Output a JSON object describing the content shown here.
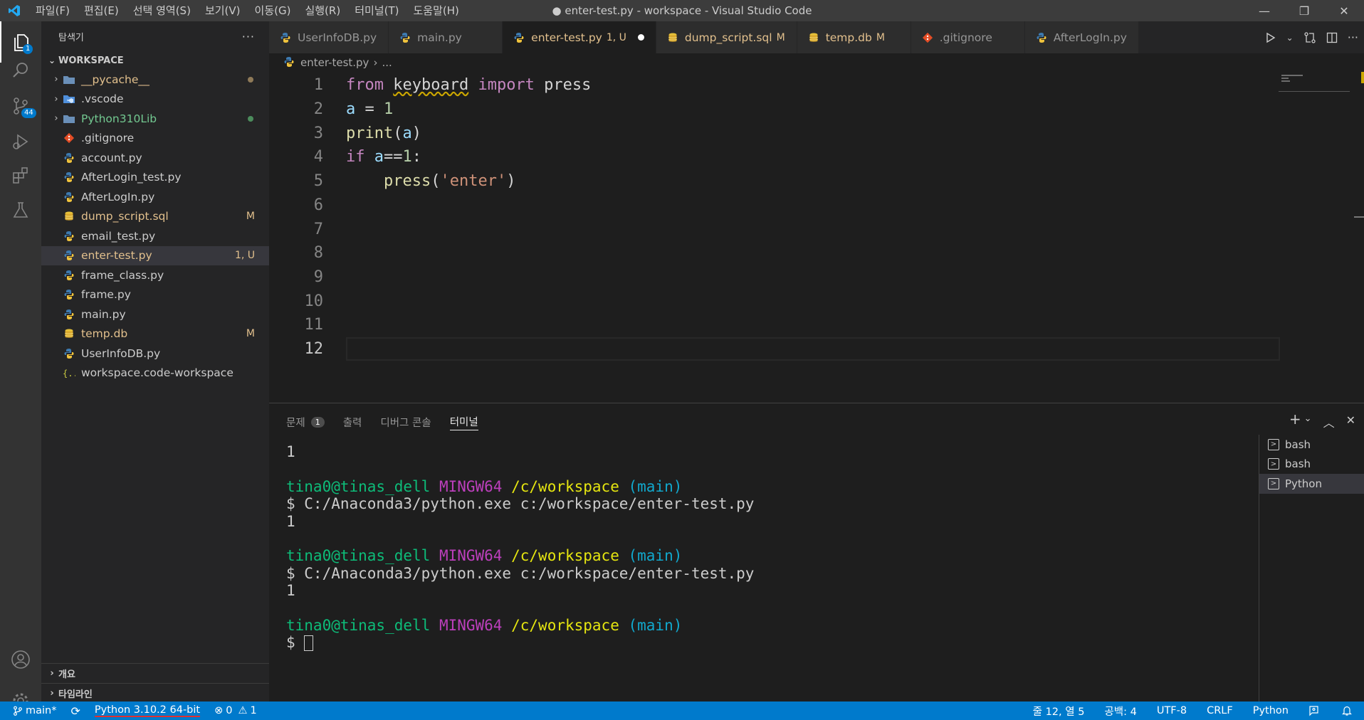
{
  "titlebar": {
    "menu": [
      "파일(F)",
      "편집(E)",
      "선택 영역(S)",
      "보기(V)",
      "이동(G)",
      "실행(R)",
      "터미널(T)",
      "도움말(H)"
    ],
    "title": "● enter-test.py - workspace - Visual Studio Code",
    "controls": {
      "minimize": "—",
      "restore": "❐",
      "close": "✕"
    }
  },
  "activitybar": {
    "explorer_badge": "1",
    "scm_badge": "44"
  },
  "sidebar": {
    "title": "탐색기",
    "more": "···",
    "workspace_label": "WORKSPACE",
    "items": [
      {
        "name": "__pycache__",
        "type": "folder",
        "chevron": "›",
        "deco": "dot",
        "color": "#e2c08d",
        "dotcolor": "#8f7a58"
      },
      {
        "name": ".vscode",
        "type": "vscode-folder",
        "chevron": "›",
        "deco": "",
        "color": "#cccccc"
      },
      {
        "name": "Python310Lib",
        "type": "folder",
        "chevron": "›",
        "deco": "dot",
        "color": "#73c991",
        "dotcolor": "#4c8c5c"
      },
      {
        "name": ".gitignore",
        "type": "git",
        "chevron": "",
        "deco": "",
        "color": "#cccccc"
      },
      {
        "name": "account.py",
        "type": "python",
        "chevron": "",
        "deco": "",
        "color": "#cccccc"
      },
      {
        "name": "AfterLogin_test.py",
        "type": "python",
        "chevron": "",
        "deco": "",
        "color": "#cccccc"
      },
      {
        "name": "AfterLogIn.py",
        "type": "python",
        "chevron": "",
        "deco": "",
        "color": "#cccccc"
      },
      {
        "name": "dump_script.sql",
        "type": "db",
        "chevron": "",
        "deco": "M",
        "color": "#e2c08d"
      },
      {
        "name": "email_test.py",
        "type": "python",
        "chevron": "",
        "deco": "",
        "color": "#cccccc"
      },
      {
        "name": "enter-test.py",
        "type": "python",
        "chevron": "",
        "deco": "1, U",
        "color": "#e2c08d",
        "selected": true
      },
      {
        "name": "frame_class.py",
        "type": "python",
        "chevron": "",
        "deco": "",
        "color": "#cccccc"
      },
      {
        "name": "frame.py",
        "type": "python",
        "chevron": "",
        "deco": "",
        "color": "#cccccc"
      },
      {
        "name": "main.py",
        "type": "python",
        "chevron": "",
        "deco": "",
        "color": "#cccccc"
      },
      {
        "name": "temp.db",
        "type": "db",
        "chevron": "",
        "deco": "M",
        "color": "#e2c08d"
      },
      {
        "name": "UserInfoDB.py",
        "type": "python",
        "chevron": "",
        "deco": "",
        "color": "#cccccc"
      },
      {
        "name": "workspace.code-workspace",
        "type": "json",
        "chevron": "",
        "deco": "",
        "color": "#cccccc"
      }
    ],
    "outline_label": "개요",
    "timeline_label": "타임라인"
  },
  "tabs": [
    {
      "label": "UserInfoDB.py",
      "type": "python",
      "meta": "",
      "active": false
    },
    {
      "label": "main.py",
      "type": "python",
      "meta": "",
      "active": false
    },
    {
      "label": "enter-test.py",
      "type": "python",
      "meta": "1, U",
      "active": true,
      "dirty": true
    },
    {
      "label": "dump_script.sql",
      "type": "db",
      "meta": "M",
      "active": false,
      "color": "#e2c08d"
    },
    {
      "label": "temp.db",
      "type": "db",
      "meta": "M",
      "active": false,
      "color": "#e2c08d"
    },
    {
      "label": ".gitignore",
      "type": "git",
      "meta": "",
      "active": false
    },
    {
      "label": "AfterLogIn.py",
      "type": "python",
      "meta": "",
      "active": false
    }
  ],
  "breadcrumb": {
    "file": "enter-test.py",
    "sep": "›",
    "rest": "..."
  },
  "editor": {
    "current_line": 12,
    "lines": [
      [
        {
          "t": "from ",
          "c": "kw"
        },
        {
          "t": "keyboard",
          "c": "squig"
        },
        {
          "t": " "
        },
        {
          "t": "import",
          "c": "kw"
        },
        {
          "t": " press"
        }
      ],
      [
        {
          "t": "a",
          "c": "var"
        },
        {
          "t": " = "
        },
        {
          "t": "1",
          "c": "num"
        }
      ],
      [
        {
          "t": "print",
          "c": "fn"
        },
        {
          "t": "("
        },
        {
          "t": "a",
          "c": "var"
        },
        {
          "t": ")"
        }
      ],
      [
        {
          "t": "if",
          "c": "kw"
        },
        {
          "t": " "
        },
        {
          "t": "a",
          "c": "var"
        },
        {
          "t": "=="
        },
        {
          "t": "1",
          "c": "num"
        },
        {
          "t": ":"
        }
      ],
      [
        {
          "t": "    "
        },
        {
          "t": "press",
          "c": "fn"
        },
        {
          "t": "("
        },
        {
          "t": "'enter'",
          "c": "str"
        },
        {
          "t": ")"
        }
      ],
      [],
      [],
      [],
      [],
      [],
      [],
      []
    ]
  },
  "panel": {
    "tabs": [
      {
        "label": "문제",
        "count": "1",
        "active": false
      },
      {
        "label": "출력",
        "active": false
      },
      {
        "label": "디버그 콘솔",
        "active": false
      },
      {
        "label": "터미널",
        "active": true
      }
    ],
    "actions": {
      "add": "+",
      "dropdown": "⌄",
      "maximize": "︿",
      "close": "✕"
    },
    "terminal_lines": [
      [
        {
          "t": "1"
        }
      ],
      [],
      [
        {
          "t": "tina0@tinas_dell",
          "c": "tg"
        },
        {
          "t": " "
        },
        {
          "t": "MINGW64",
          "c": "tm"
        },
        {
          "t": " "
        },
        {
          "t": "/c/workspace",
          "c": "ty"
        },
        {
          "t": " "
        },
        {
          "t": "(main)",
          "c": "tc"
        }
      ],
      [
        {
          "t": "$ C:/Anaconda3/python.exe c:/workspace/enter-test.py"
        }
      ],
      [
        {
          "t": "1"
        }
      ],
      [],
      [
        {
          "t": "tina0@tinas_dell",
          "c": "tg"
        },
        {
          "t": " "
        },
        {
          "t": "MINGW64",
          "c": "tm"
        },
        {
          "t": " "
        },
        {
          "t": "/c/workspace",
          "c": "ty"
        },
        {
          "t": " "
        },
        {
          "t": "(main)",
          "c": "tc"
        }
      ],
      [
        {
          "t": "$ C:/Anaconda3/python.exe c:/workspace/enter-test.py"
        }
      ],
      [
        {
          "t": "1"
        }
      ],
      [],
      [
        {
          "t": "tina0@tinas_dell",
          "c": "tg"
        },
        {
          "t": " "
        },
        {
          "t": "MINGW64",
          "c": "tm"
        },
        {
          "t": " "
        },
        {
          "t": "/c/workspace",
          "c": "ty"
        },
        {
          "t": " "
        },
        {
          "t": "(main)",
          "c": "tc"
        }
      ],
      [
        {
          "t": "$ "
        },
        {
          "t": "",
          "c": "cursor"
        }
      ]
    ],
    "terminals": [
      {
        "label": "bash",
        "selected": false
      },
      {
        "label": "bash",
        "selected": false
      },
      {
        "label": "Python",
        "selected": true
      }
    ]
  },
  "statusbar": {
    "branch": "main*",
    "interpreter": "Python 3.10.2 64-bit",
    "errors": "0",
    "warnings": "1",
    "position": "줄 12, 열 5",
    "spaces": "공백: 4",
    "encoding": "UTF-8",
    "eol": "CRLF",
    "language": "Python"
  },
  "colors": {
    "accent": "#007acc",
    "modified": "#e2c08d",
    "untracked": "#73c991"
  }
}
